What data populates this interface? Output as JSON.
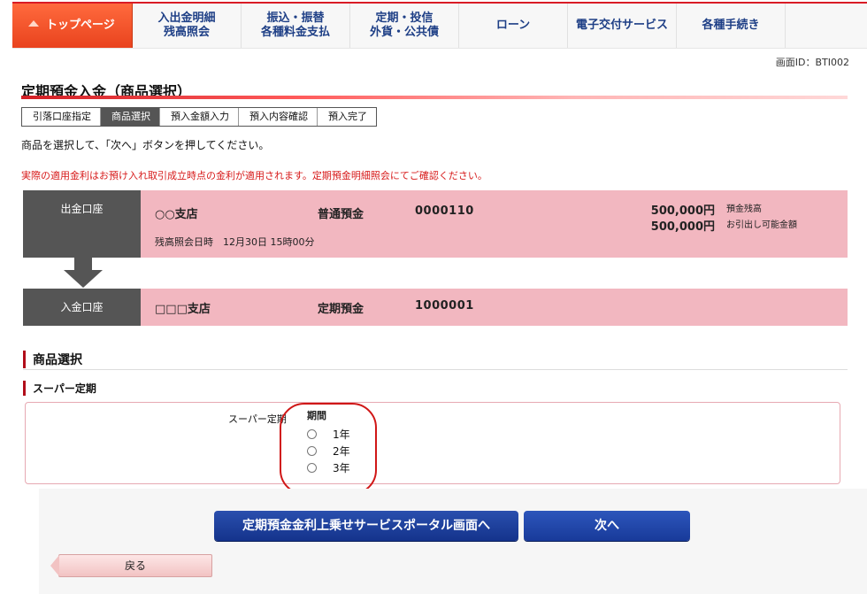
{
  "nav": {
    "items": [
      {
        "label": "トップページ",
        "active": true
      },
      {
        "label": "入出金明細\n残高照会"
      },
      {
        "label": "振込・振替\n各種料金支払"
      },
      {
        "label": "定期・投信\n外貨・公共債"
      },
      {
        "label": "ローン"
      },
      {
        "label": "電子交付サービス"
      },
      {
        "label": "各種手続き"
      }
    ]
  },
  "header": {
    "screen_id": "画面ID：BTI002",
    "title": "定期預金入金（商品選択）"
  },
  "steps": [
    "引落口座指定",
    "商品選択",
    "預入金額入力",
    "預入内容確認",
    "預入完了"
  ],
  "instruction": "商品を選択して、「次へ」ボタンを押してください。",
  "notice": "実際の適用金利はお預け入れ取引成立時点の金利が適用されます。定期預金明細照会にてご確認ください。",
  "withdraw_account": {
    "label": "出金口座",
    "branch": "○○支店",
    "kind": "普通預金",
    "number": "0000110",
    "inquiry": "残高照会日時　12月30日 15時00分",
    "balance_amount": "500,000円",
    "balance_label": "預金残高",
    "available_amount": "500,000円",
    "available_label": "お引出し可能金額"
  },
  "deposit_account": {
    "label": "入金口座",
    "branch": "□□□支店",
    "kind": "定期預金",
    "number": "1000001"
  },
  "product_section": {
    "title": "商品選択",
    "subtitle": "スーパー定期",
    "product_name": "スーパー定期",
    "period_label": "期間",
    "options": [
      "1年",
      "2年",
      "3年"
    ]
  },
  "buttons": {
    "portal": "定期預金金利上乗せサービスポータル画面へ",
    "next": "次へ",
    "back": "戻る"
  },
  "colors": {
    "accent_red": "#d91b25",
    "pink": "#f2b7c0",
    "navy_button": "#1d3f99"
  }
}
